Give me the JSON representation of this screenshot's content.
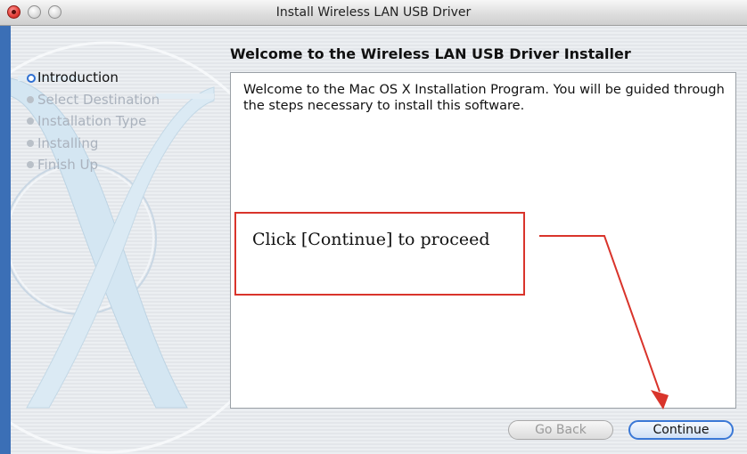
{
  "window": {
    "title": "Install Wireless LAN USB Driver"
  },
  "sidebar": {
    "steps": [
      {
        "label": "Introduction",
        "state": "current"
      },
      {
        "label": "Select Destination",
        "state": "pending"
      },
      {
        "label": "Installation Type",
        "state": "pending"
      },
      {
        "label": "Installing",
        "state": "pending"
      },
      {
        "label": "Finish Up",
        "state": "pending"
      }
    ]
  },
  "main": {
    "heading": "Welcome to the Wireless LAN USB Driver Installer",
    "body": "Welcome to the Mac OS X Installation Program. You will be guided through the steps necessary to install this software."
  },
  "callout": {
    "text": "Click [Continue] to proceed"
  },
  "buttons": {
    "go_back": "Go Back",
    "continue": "Continue"
  },
  "icons": {
    "close": "close-icon",
    "minimize": "minimize-icon",
    "zoom": "zoom-icon",
    "arrow": "arrow-icon"
  },
  "colors": {
    "accent": "#3a78d6",
    "callout_border": "#d9342b",
    "close_button": "#e5423b"
  }
}
